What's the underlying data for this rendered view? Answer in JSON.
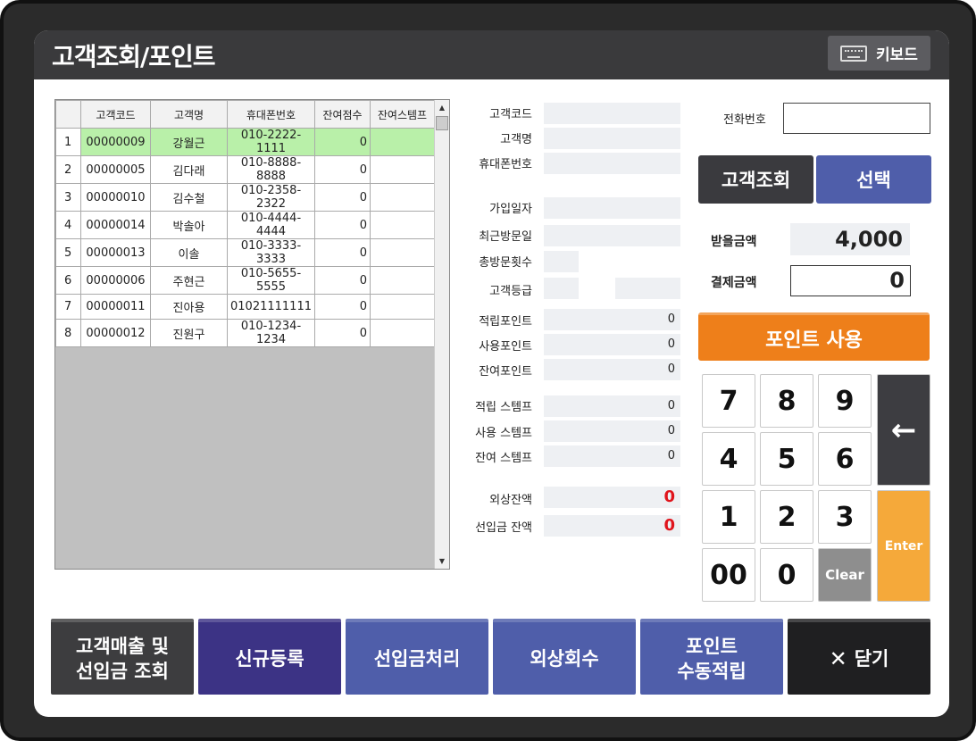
{
  "window": {
    "title": "고객조회/포인트",
    "keyboard_label": "키보드"
  },
  "grid": {
    "columns": [
      "",
      "고객코드",
      "고객명",
      "휴대폰번호",
      "잔여점수",
      "잔여스템프"
    ],
    "rows": [
      {
        "no": "1",
        "code": "00000009",
        "name": "강월근",
        "phone": "010-2222-1111",
        "points": "0",
        "stamps": ""
      },
      {
        "no": "2",
        "code": "00000005",
        "name": "김다래",
        "phone": "010-8888-8888",
        "points": "0",
        "stamps": ""
      },
      {
        "no": "3",
        "code": "00000010",
        "name": "김수철",
        "phone": "010-2358-2322",
        "points": "0",
        "stamps": ""
      },
      {
        "no": "4",
        "code": "00000014",
        "name": "박솔아",
        "phone": "010-4444-4444",
        "points": "0",
        "stamps": ""
      },
      {
        "no": "5",
        "code": "00000013",
        "name": "이솔",
        "phone": "010-3333-3333",
        "points": "0",
        "stamps": ""
      },
      {
        "no": "6",
        "code": "00000006",
        "name": "주현근",
        "phone": "010-5655-5555",
        "points": "0",
        "stamps": ""
      },
      {
        "no": "7",
        "code": "00000011",
        "name": "진아용",
        "phone": "01021111111",
        "points": "0",
        "stamps": ""
      },
      {
        "no": "8",
        "code": "00000012",
        "name": "진원구",
        "phone": "010-1234-1234",
        "points": "0",
        "stamps": ""
      }
    ],
    "selected_row": 0
  },
  "info": {
    "customer_code_label": "고객코드",
    "customer_name_label": "고객명",
    "phone_label": "휴대폰번호",
    "join_date_label": "가입일자",
    "last_visit_label": "최근방문일",
    "visit_count_label": "총방문횟수",
    "grade_label": "고객등급",
    "earned_points_label": "적립포인트",
    "earned_points": "0",
    "used_points_label": "사용포인트",
    "used_points": "0",
    "remaining_points_label": "잔여포인트",
    "remaining_points": "0",
    "earned_stamps_label": "적립 스템프",
    "earned_stamps": "0",
    "used_stamps_label": "사용 스템프",
    "used_stamps": "0",
    "remaining_stamps_label": "잔여 스템프",
    "remaining_stamps": "0",
    "credit_balance_label": "외상잔액",
    "credit_balance": "0",
    "prepaid_balance_label": "선입금 잔액",
    "prepaid_balance": "0"
  },
  "search": {
    "phone_label": "전화번호",
    "phone_value": "",
    "lookup_button": "고객조회",
    "select_button": "선택"
  },
  "amounts": {
    "receivable_label": "받을금액",
    "receivable": "4,000",
    "payment_label": "결제금액",
    "payment": "0",
    "use_points_button": "포인트 사용"
  },
  "keypad": {
    "keys": [
      "7",
      "8",
      "9",
      "4",
      "5",
      "6",
      "1",
      "2",
      "3",
      "00",
      "0",
      "Clear"
    ],
    "backspace": "←",
    "enter": "Enter"
  },
  "bottom": {
    "sales_line1": "고객매출 및",
    "sales_line2": "선입금 조회",
    "register": "신규등록",
    "prepaid": "선입금처리",
    "credit": "외상회수",
    "manual_line1": "포인트",
    "manual_line2": "수동적립",
    "close": "닫기"
  },
  "colors": {
    "title_bar": "#3a3a3c",
    "select_blue": "#4f5eaa",
    "orange": "#ee7f1a",
    "enter_orange": "#f5a93a",
    "selected_row": "#b9f0a9",
    "navy": "#3c3385",
    "red_value": "#e0141c"
  }
}
